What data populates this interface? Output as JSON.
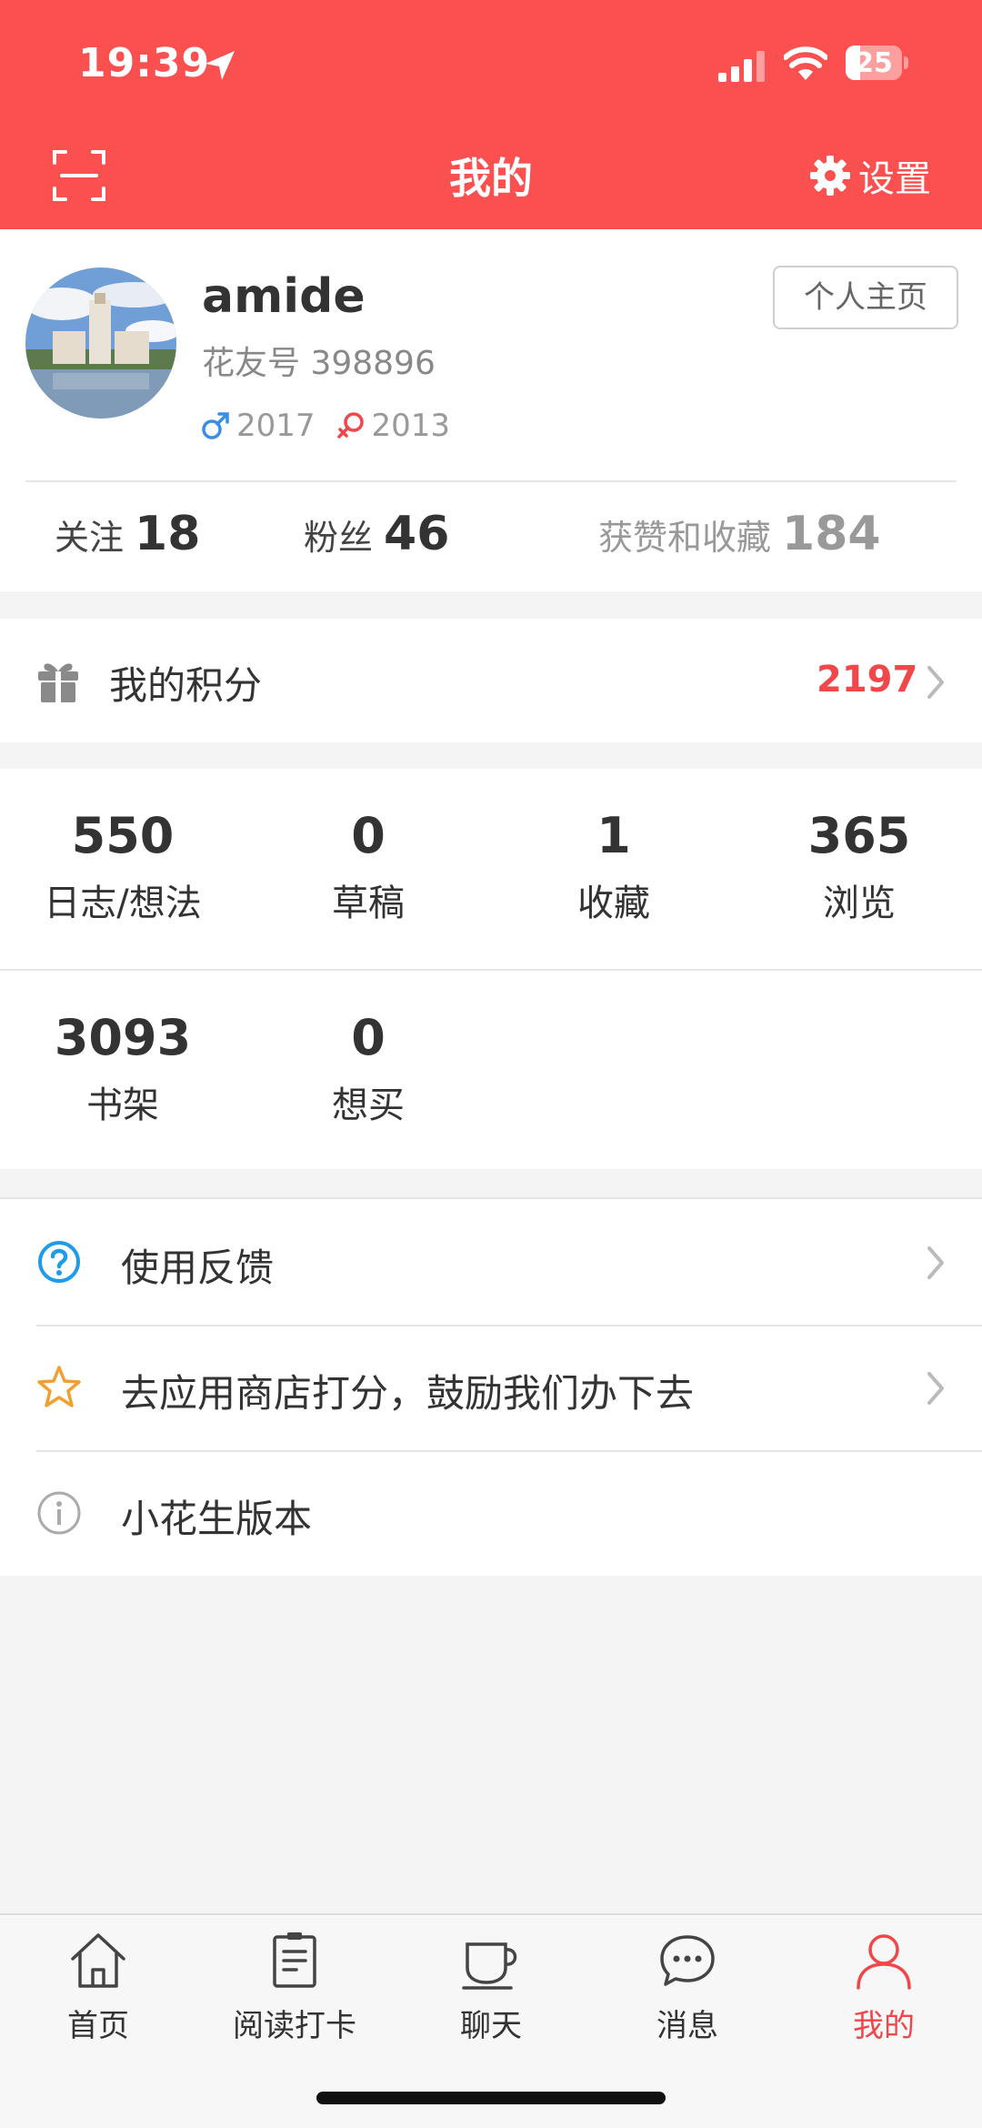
{
  "status_bar": {
    "time": "19:39",
    "battery": "25"
  },
  "header": {
    "title": "我的",
    "settings_label": "设置"
  },
  "profile": {
    "username": "amide",
    "user_id": "花友号 398896",
    "male_year": "2017",
    "female_year": "2013",
    "homepage_button": "个人主页",
    "stats": [
      {
        "label": "关注",
        "value": "18"
      },
      {
        "label": "粉丝",
        "value": "46"
      },
      {
        "label": "获赞和收藏",
        "value": "184"
      }
    ]
  },
  "points": {
    "label": "我的积分",
    "value": "2197"
  },
  "counts": [
    {
      "value": "550",
      "label": "日志/想法"
    },
    {
      "value": "0",
      "label": "草稿"
    },
    {
      "value": "1",
      "label": "收藏"
    },
    {
      "value": "365",
      "label": "浏览"
    },
    {
      "value": "3093",
      "label": "书架"
    },
    {
      "value": "0",
      "label": "想买"
    }
  ],
  "menu": [
    {
      "label": "使用反馈",
      "icon": "question-circle-icon"
    },
    {
      "label": "去应用商店打分，鼓励我们办下去",
      "icon": "star-icon"
    },
    {
      "label": "小花生版本",
      "icon": "info-icon"
    }
  ],
  "tabs": [
    {
      "label": "首页",
      "icon": "home-icon"
    },
    {
      "label": "阅读打卡",
      "icon": "checkin-icon"
    },
    {
      "label": "聊天",
      "icon": "cup-icon"
    },
    {
      "label": "消息",
      "icon": "chat-bubble-icon"
    },
    {
      "label": "我的",
      "icon": "person-icon"
    }
  ],
  "colors": {
    "brand_red": "#fb5050",
    "accent_red": "#f0474b",
    "male_blue": "#3a8ee6",
    "female_red": "#f0474b",
    "question_blue": "#1e9be9",
    "star_orange": "#f0a030"
  }
}
